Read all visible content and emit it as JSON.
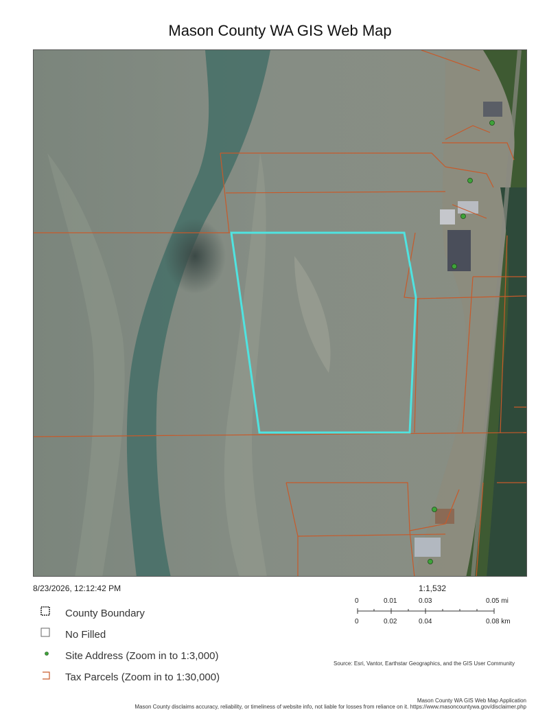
{
  "title": "Mason County WA GIS Web Map",
  "timestamp": "8/23/2026, 12:12:42 PM",
  "scale": {
    "ratio": "1:1,532",
    "top_labels": [
      "0",
      "0.01",
      "0.03",
      "0.05 mi"
    ],
    "bottom_labels": [
      "0",
      "0.02",
      "0.04",
      "0.08 km"
    ]
  },
  "legend": [
    {
      "label": "County Boundary",
      "icon": "county-boundary-icon"
    },
    {
      "label": "No Filled",
      "icon": "no-filled-icon"
    },
    {
      "label": "Site Address (Zoom in to 1:3,000)",
      "icon": "site-address-dot-icon"
    },
    {
      "label": "Tax Parcels (Zoom in to 1:30,000)",
      "icon": "tax-parcel-icon"
    }
  ],
  "source": "Source: Esri, Vantor, Earthstar Geographics, and the GIS User Community",
  "footer": {
    "app": "Mason County WA GIS Web Map Application",
    "disclaimer": "Mason County disclaims accuracy, reliability, or timeliness of website info, not liable for losses from reliance on it. https://www.masoncountywa.gov/disclaimer.php"
  },
  "colors": {
    "parcel_line": "#c75a2a",
    "selected_parcel": "#4fe3e0",
    "site_address": "#3fa33a",
    "tideflat": "#7c867c",
    "channel": "#3f6a63",
    "shore_vegetation": "#3d5a2c"
  }
}
